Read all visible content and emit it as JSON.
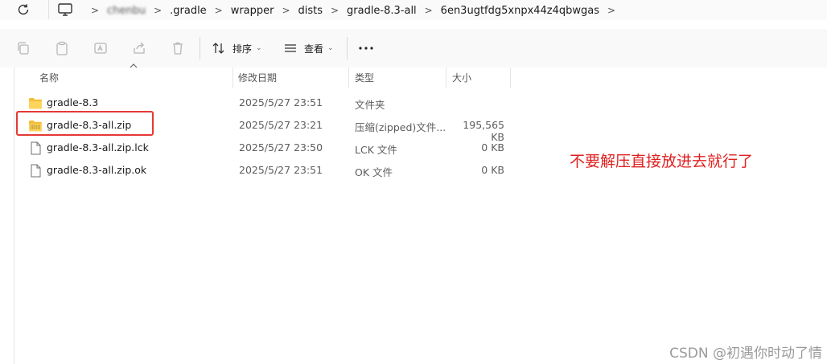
{
  "address_bar": {
    "crumbs": [
      "chenbu",
      ".gradle",
      "wrapper",
      "dists",
      "gradle-8.3-all",
      "6en3ugtfdg5xnpx44z4qbwgas"
    ],
    "separator": ">"
  },
  "toolbar": {
    "sort_label": "排序",
    "view_label": "查看",
    "more_label": "..."
  },
  "columns": {
    "name": "名称",
    "modified": "修改日期",
    "type": "类型",
    "size": "大小"
  },
  "files": [
    {
      "name": "gradle-8.3",
      "modified": "2025/5/27 23:51",
      "type": "文件夹",
      "size": "",
      "icon": "folder-icon"
    },
    {
      "name": "gradle-8.3-all.zip",
      "modified": "2025/5/27 23:21",
      "type": "压缩(zipped)文件...",
      "size": "195,565 KB",
      "icon": "zip-folder-icon"
    },
    {
      "name": "gradle-8.3-all.zip.lck",
      "modified": "2025/5/27 23:50",
      "type": "LCK 文件",
      "size": "0 KB",
      "icon": "file-icon"
    },
    {
      "name": "gradle-8.3-all.zip.ok",
      "modified": "2025/5/27 23:51",
      "type": "OK 文件",
      "size": "0 KB",
      "icon": "file-icon"
    }
  ],
  "annotation": "不要解压直接放进去就行了",
  "watermark": "CSDN @初遇你时动了情",
  "colors": {
    "annotation": "#e02020",
    "highlight_border": "#e53935",
    "folder": "#f4c430"
  }
}
